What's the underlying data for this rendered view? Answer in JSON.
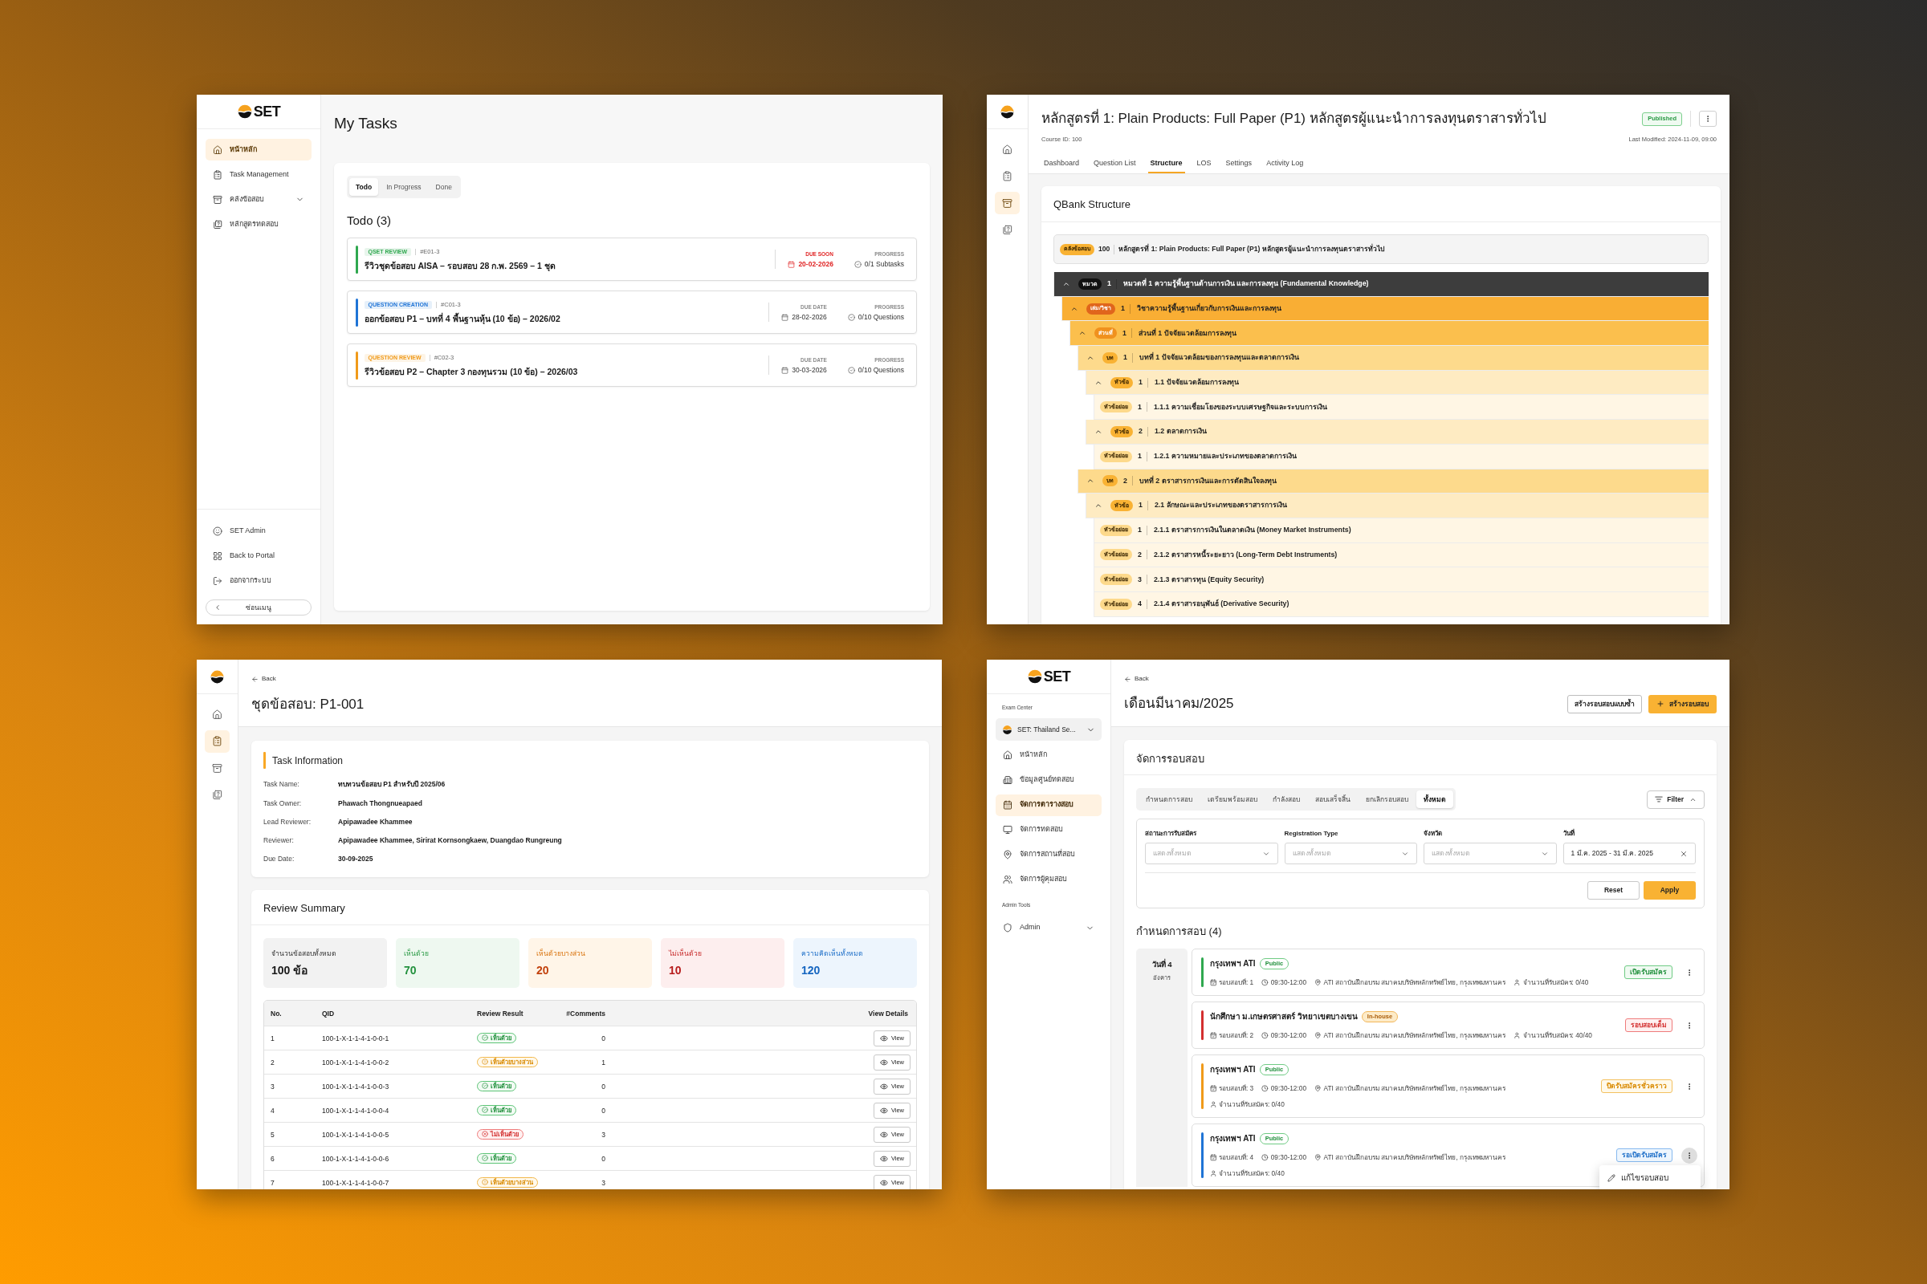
{
  "my_tasks_window": {
    "sidebar": {
      "brand": "SET",
      "items": [
        {
          "label": "หน้าหลัก",
          "selected": true
        },
        {
          "label": "Task Management",
          "selected": false
        },
        {
          "label": "คลังข้อสอบ",
          "selected": false,
          "expanded": false
        },
        {
          "label": "หลักสูตรทดสอบ",
          "selected": false
        }
      ],
      "footer_items": [
        {
          "label": "SET Admin"
        },
        {
          "label": "Back to Portal"
        },
        {
          "label": "ออกจากระบบ"
        }
      ],
      "collapse_button": "ซ่อนเมนู"
    },
    "title": "My Tasks",
    "tabs": [
      {
        "label": "Todo",
        "selected": true
      },
      {
        "label": "In Progress",
        "selected": false
      },
      {
        "label": "Done",
        "selected": false
      }
    ],
    "list_title": "Todo (3)",
    "tasks": [
      {
        "category": "QSET REVIEW",
        "code": "#E01-3",
        "color": "#2fa84f",
        "title": "รีวิวชุดข้อสอบ AISA – รอบสอบ 28 ก.พ. 2569 – 1 ชุด",
        "due_label": "DUE SOON",
        "due_date": "20-02-2026",
        "due_soon": true,
        "progress_label": "PROGRESS",
        "progress": "0/1 Subtasks"
      },
      {
        "category": "QUESTION CREATION",
        "code": "#C01-3",
        "color": "#1f74d6",
        "title": "ออกข้อสอบ P1 – บทที่ 4 พื้นฐานหุ้น (10 ข้อ) – 2026/02",
        "due_label": "DUE DATE",
        "due_date": "28-02-2026",
        "due_soon": false,
        "progress_label": "PROGRESS",
        "progress": "0/10 Questions"
      },
      {
        "category": "QUESTION REVIEW",
        "code": "#C02-3",
        "color": "#f09a1a",
        "title": "รีวิวข้อสอบ P2 – Chapter 3 กองทุนรวม (10 ข้อ) – 2026/03",
        "due_label": "DUE DATE",
        "due_date": "30-03-2026",
        "due_soon": false,
        "progress_label": "PROGRESS",
        "progress": "0/10 Questions"
      }
    ]
  },
  "course_window": {
    "sidebar": {
      "items": [
        {
          "selected": false
        },
        {
          "selected": false
        },
        {
          "selected": true
        },
        {
          "selected": false
        }
      ]
    },
    "title": "หลักสูตรที่ 1: Plain Products: Full Paper (P1) หลักสูตรผู้แนะนำการลงทุนตราสารทั่วไป",
    "status": "Published",
    "course_id": "Course ID: 100",
    "last_modified": "Last Modified: 2024-11-09, 09:00",
    "tabs": [
      {
        "label": "Dashboard",
        "selected": false
      },
      {
        "label": "Question List",
        "selected": false
      },
      {
        "label": "Structure",
        "selected": true
      },
      {
        "label": "LOS",
        "selected": false
      },
      {
        "label": "Settings",
        "selected": false
      },
      {
        "label": "Activity Log",
        "selected": false
      }
    ],
    "structure": {
      "title": "QBank Structure",
      "bank": {
        "badge": "คลังข้อสอบ",
        "number": "100",
        "title": "หลักสูตรที่ 1: Plain Products: Full Paper (P1) หลักสูตรผู้แนะนำการลงทุนตราสารทั่วไป"
      },
      "tree": [
        {
          "kind": "category",
          "badge": "หมวด",
          "number": "1",
          "title": "หมวดที่ 1 ความรู้พื้นฐานด้านการเงิน และการลงทุน (Fundamental Knowledge)",
          "expanded": true,
          "children": [
            {
              "kind": "subject",
              "badge": "เล่ม/วิชา",
              "number": "1",
              "title": "วิชาความรู้พื้นฐานเกี่ยวกับการเงินและการลงทุน",
              "expanded": true,
              "children": [
                {
                  "kind": "part",
                  "badge": "ส่วนที่",
                  "number": "1",
                  "title": "ส่วนที่ 1 ปัจจัยแวดล้อมการลงทุน",
                  "expanded": true,
                  "children": [
                    {
                      "kind": "chapter",
                      "badge": "บท",
                      "number": "1",
                      "title": "บทที่ 1 ปัจจัยแวดล้อมของการลงทุนและตลาดการเงิน",
                      "expanded": true,
                      "children": [
                        {
                          "kind": "topic",
                          "badge": "หัวข้อ",
                          "number": "1",
                          "title": "1.1 ปัจจัยแวดล้อมการลงทุน",
                          "expanded": true,
                          "children": [
                            {
                              "kind": "subtopic",
                              "badge": "หัวข้อย่อย",
                              "number": "1",
                              "title": "1.1.1 ความเชื่อมโยงของระบบเศรษฐกิจและระบบการเงิน"
                            }
                          ]
                        },
                        {
                          "kind": "topic",
                          "badge": "หัวข้อ",
                          "number": "2",
                          "title": "1.2 ตลาดการเงิน",
                          "expanded": true,
                          "children": [
                            {
                              "kind": "subtopic",
                              "badge": "หัวข้อย่อย",
                              "number": "1",
                              "title": "1.2.1 ความหมายและประเภทของตลาดการเงิน"
                            }
                          ]
                        }
                      ]
                    },
                    {
                      "kind": "chapter",
                      "badge": "บท",
                      "number": "2",
                      "title": "บทที่ 2 ตราสารการเงินและการตัดสินใจลงทุน",
                      "expanded": true,
                      "children": [
                        {
                          "kind": "topic",
                          "badge": "หัวข้อ",
                          "number": "1",
                          "title": "2.1 ลักษณะและประเภทของตราสารการเงิน",
                          "expanded": true,
                          "children": [
                            {
                              "kind": "subtopic",
                              "badge": "หัวข้อย่อย",
                              "number": "1",
                              "title": "2.1.1 ตราสารการเงินในตลาดเงิน (Money Market Instruments)"
                            },
                            {
                              "kind": "subtopic",
                              "badge": "หัวข้อย่อย",
                              "number": "2",
                              "title": "2.1.2 ตราสารหนี้ระยะยาว (Long-Term Debt Instruments)"
                            },
                            {
                              "kind": "subtopic",
                              "badge": "หัวข้อย่อย",
                              "number": "3",
                              "title": "2.1.3 ตราสารทุน (Equity Security)"
                            },
                            {
                              "kind": "subtopic",
                              "badge": "หัวข้อย่อย",
                              "number": "4",
                              "title": "2.1.4 ตราสารอนุพันธ์ (Derivative Security)"
                            }
                          ]
                        }
                      ]
                    }
                  ]
                }
              ]
            }
          ]
        }
      ]
    }
  },
  "review_window": {
    "sidebar": {
      "items": [
        {
          "selected": false
        },
        {
          "selected": true
        },
        {
          "selected": false
        },
        {
          "selected": false
        }
      ]
    },
    "back": "Back",
    "title": "ชุดข้อสอบ: P1-001",
    "task_info": {
      "title": "Task Information",
      "fields": [
        {
          "label": "Task Name:",
          "value": "ทบทวนข้อสอบ P1 สำหรับปี 2025/06"
        },
        {
          "label": "Task Owner:",
          "value": "Phawach Thongnueapaed"
        },
        {
          "label": "Lead Reviewer:",
          "value": "Apipawadee Khammee"
        },
        {
          "label": "Reviewer:",
          "value": "Apipawadee Khammee, Sirirat Kornsongkaew, Duangdao Rungreung"
        },
        {
          "label": "Due Date:",
          "value": "30-09-2025"
        }
      ]
    },
    "summary": {
      "title": "Review Summary",
      "stats": [
        {
          "kind": "total",
          "label": "จำนวนข้อสอบทั้งหมด",
          "value": "100 ข้อ"
        },
        {
          "kind": "agree",
          "label": "เห็นด้วย",
          "value": "70"
        },
        {
          "kind": "partial",
          "label": "เห็นด้วยบางส่วน",
          "value": "20"
        },
        {
          "kind": "disagree",
          "label": "ไม่เห็นด้วย",
          "value": "10"
        },
        {
          "kind": "comments",
          "label": "ความคิดเห็นทั้งหมด",
          "value": "120"
        }
      ],
      "table": {
        "columns": [
          "No.",
          "QID",
          "Review Result",
          "#Comments",
          "View Details"
        ],
        "rows": [
          {
            "no": "1",
            "qid": "100-1-X-1-1-4-1-0-0-1",
            "result": {
              "label": "เห็นด้วย",
              "kind": "agree"
            },
            "comments": "0",
            "action": "View"
          },
          {
            "no": "2",
            "qid": "100-1-X-1-1-4-1-0-0-2",
            "result": {
              "label": "เห็นด้วยบางส่วน",
              "kind": "partial"
            },
            "comments": "1",
            "action": "View"
          },
          {
            "no": "3",
            "qid": "100-1-X-1-1-4-1-0-0-3",
            "result": {
              "label": "เห็นด้วย",
              "kind": "agree"
            },
            "comments": "0",
            "action": "View"
          },
          {
            "no": "4",
            "qid": "100-1-X-1-1-4-1-0-0-4",
            "result": {
              "label": "เห็นด้วย",
              "kind": "agree"
            },
            "comments": "0",
            "action": "View"
          },
          {
            "no": "5",
            "qid": "100-1-X-1-1-4-1-0-0-5",
            "result": {
              "label": "ไม่เห็นด้วย",
              "kind": "disagree"
            },
            "comments": "3",
            "action": "View"
          },
          {
            "no": "6",
            "qid": "100-1-X-1-1-4-1-0-0-6",
            "result": {
              "label": "เห็นด้วย",
              "kind": "agree"
            },
            "comments": "0",
            "action": "View"
          },
          {
            "no": "7",
            "qid": "100-1-X-1-1-4-1-0-0-7",
            "result": {
              "label": "เห็นด้วยบางส่วน",
              "kind": "partial"
            },
            "comments": "3",
            "action": "View"
          }
        ]
      }
    }
  },
  "schedule_window": {
    "sidebar": {
      "brand": "SET",
      "section_label": "Exam Center",
      "org_select": {
        "label": "SET: Thailand Se...",
        "expanded": false
      },
      "items": [
        {
          "label": "หน้าหลัก",
          "selected": false
        },
        {
          "label": "ข้อมูลศูนย์ทดสอบ",
          "selected": false
        },
        {
          "label": "จัดการตารางสอบ",
          "selected": true
        },
        {
          "label": "จัดการทดสอบ",
          "selected": false
        },
        {
          "label": "จัดการสถานที่สอบ",
          "selected": false
        },
        {
          "label": "จัดการผู้คุมสอบ",
          "selected": false
        }
      ],
      "admin_label": "Admin Tools",
      "admin_items": [
        {
          "label": "Admin",
          "selected": false,
          "expanded": false
        }
      ]
    },
    "back": "Back",
    "title": "เดือนมีนาคม/2025",
    "actions": [
      {
        "label": "สร้างรอบสอบแบบซ้ำ",
        "kind": "secondary"
      },
      {
        "label": "สร้างรอบสอบ",
        "kind": "primary"
      }
    ],
    "panel_title": "จัดการรอบสอบ",
    "tabs": [
      {
        "label": "กำหนดการสอบ",
        "selected": false
      },
      {
        "label": "เตรียมพร้อมสอบ",
        "selected": false
      },
      {
        "label": "กำลังสอบ",
        "selected": false
      },
      {
        "label": "สอบเสร็จสิ้น",
        "selected": false
      },
      {
        "label": "ยกเลิกรอบสอบ",
        "selected": false
      },
      {
        "label": "ทั้งหมด",
        "selected": true
      }
    ],
    "filter": {
      "label": "Filter",
      "expanded": true,
      "fields": [
        {
          "kind": "select",
          "label": "สถานะการรับสมัคร",
          "placeholder": "แสดงทั้งหมด"
        },
        {
          "kind": "select",
          "label": "Registration Type",
          "placeholder": "แสดงทั้งหมด"
        },
        {
          "kind": "select",
          "label": "จังหวัด",
          "placeholder": "แสดงทั้งหมด"
        },
        {
          "kind": "date",
          "label": "วันที่",
          "value": "1 มี.ค. 2025 - 31 มี.ค. 2025"
        }
      ],
      "buttons": [
        {
          "label": "Reset",
          "kind": "secondary"
        },
        {
          "label": "Apply",
          "kind": "primary"
        }
      ]
    },
    "schedule": {
      "title": "กำหนดการสอบ (4)",
      "days": [
        {
          "day": "วันที่ 4",
          "weekday": "อังคาร",
          "sessions": [
            {
              "title": "กรุงเทพฯ ATI",
              "audience": {
                "label": "Public",
                "kind": "public"
              },
              "round": "รอบสอบที่: 1",
              "time": "09:30-12:00",
              "location": "ATI สถาบันฝึกอบรม สมาคมบริษัทหลักทรัพย์ไทย, กรุงเทพมหานคร",
              "capacity": "จำนวนที่รับสมัคร: 0/40",
              "status": {
                "label": "เปิดรับสมัคร",
                "kind": "open"
              },
              "color": "#2fa84f",
              "menu_open": false
            },
            {
              "title": "นักศึกษา ม.เกษตรศาสตร์ วิทยาเขตบางเขน",
              "audience": {
                "label": "In-house",
                "kind": "inhouse"
              },
              "round": "รอบสอบที่: 2",
              "time": "09:30-12:00",
              "location": "ATI สถาบันฝึกอบรม สมาคมบริษัทหลักทรัพย์ไทย, กรุงเทพมหานคร",
              "capacity": "จำนวนที่รับสมัคร: 40/40",
              "status": {
                "label": "รอบสอบเต็ม",
                "kind": "full"
              },
              "color": "#d32f2f",
              "menu_open": false
            },
            {
              "title": "กรุงเทพฯ ATI",
              "audience": {
                "label": "Public",
                "kind": "public"
              },
              "round": "รอบสอบที่: 3",
              "time": "09:30-12:00",
              "location": "ATI สถาบันฝึกอบรม สมาคมบริษัทหลักทรัพย์ไทย, กรุงเทพมหานคร",
              "capacity": "จำนวนที่รับสมัคร: 0/40",
              "status": {
                "label": "ปิดรับสมัครชั่วคราว",
                "kind": "paused"
              },
              "color": "#f09a1a",
              "menu_open": false
            },
            {
              "title": "กรุงเทพฯ ATI",
              "audience": {
                "label": "Public",
                "kind": "public"
              },
              "round": "รอบสอบที่: 4",
              "time": "09:30-12:00",
              "location": "ATI สถาบันฝึกอบรม สมาคมบริษัทหลักทรัพย์ไทย, กรุงเทพมหานคร",
              "capacity": "จำนวนที่รับสมัคร: 0/40",
              "status": {
                "label": "รอเปิดรับสมัคร",
                "kind": "pending"
              },
              "color": "#1f74d6",
              "menu_open": true
            }
          ]
        }
      ]
    },
    "context_menu": {
      "items": [
        "แก้ไขรอบสอบ"
      ]
    }
  }
}
